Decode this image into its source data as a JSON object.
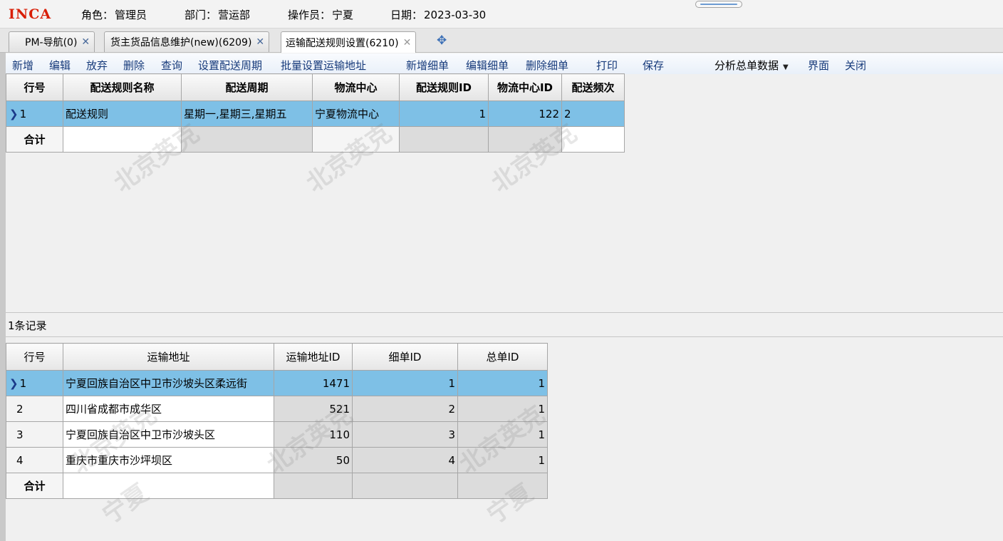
{
  "header": {
    "logo": "INCA",
    "role_label": "角色：",
    "role": "管理员",
    "dept_label": "部门：",
    "dept": "营运部",
    "operator_label": "操作员：",
    "operator": "宁夏",
    "date_label": "日期：",
    "date": "2023-03-30"
  },
  "tabs": [
    {
      "label": "PM-导航(0)"
    },
    {
      "label": "货主货品信息维护(new)(6209)"
    },
    {
      "label": "运输配送规则设置(6210)"
    }
  ],
  "toolbar": {
    "add": "新增",
    "edit": "编辑",
    "discard": "放弃",
    "delete": "删除",
    "query": "查询",
    "set_cycle": "设置配送周期",
    "batch_address": "批量设置运输地址",
    "add_detail": "新增细单",
    "edit_detail": "编辑细单",
    "delete_detail": "删除细单",
    "print": "打印",
    "save": "保存",
    "analyze": "分析总单数据",
    "interface": "界面",
    "close": "关闭"
  },
  "master_grid": {
    "columns": [
      "行号",
      "配送规则名称",
      "配送周期",
      "物流中心",
      "配送规则ID",
      "物流中心ID",
      "配送频次"
    ],
    "rows": [
      [
        "1",
        "配送规则",
        "星期一,星期三,星期五",
        "宁夏物流中心",
        "1",
        "122",
        "2"
      ]
    ],
    "sum_label": "合计"
  },
  "status": {
    "record_count": "1条记录"
  },
  "detail_grid": {
    "columns": [
      "行号",
      "运输地址",
      "运输地址ID",
      "细单ID",
      "总单ID"
    ],
    "rows": [
      [
        "1",
        "宁夏回族自治区中卫市沙坡头区柔远街",
        "1471",
        "1",
        "1"
      ],
      [
        "2",
        "四川省成都市成华区",
        "521",
        "2",
        "1"
      ],
      [
        "3",
        "宁夏回族自治区中卫市沙坡头区",
        "110",
        "3",
        "1"
      ],
      [
        "4",
        "重庆市重庆市沙坪坝区",
        "50",
        "4",
        "1"
      ]
    ],
    "sum_label": "合计"
  },
  "watermark": {
    "text1": "北京英克",
    "text2": "宁夏"
  }
}
